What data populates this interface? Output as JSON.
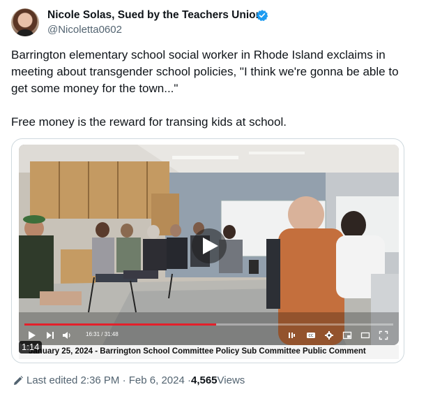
{
  "author": {
    "display_name": "Nicole Solas, Sued by the Teachers Union",
    "handle": "@Nicoletta0602",
    "verified_color": "#1d9bf0"
  },
  "tweet": {
    "text": "Barrington elementary school social worker in Rhode Island exclaims in meeting about transgender school policies, \"I think we're gonna be able to get some money for the town...\"\n\nFree money is the reward for transing kids at school."
  },
  "video": {
    "timecode": "16:31 / 31:48",
    "duration_badge": "1:14",
    "progress": 0.52,
    "caption": "January 25, 2024 - Barrington School Committee Policy Sub Committee Public Comment",
    "progress_color": "#e4202a"
  },
  "footer": {
    "edited_text": "Last edited 2:36 PM · Feb 6, 2024 · ",
    "views_count": "4,565",
    "views_label": " Views"
  }
}
